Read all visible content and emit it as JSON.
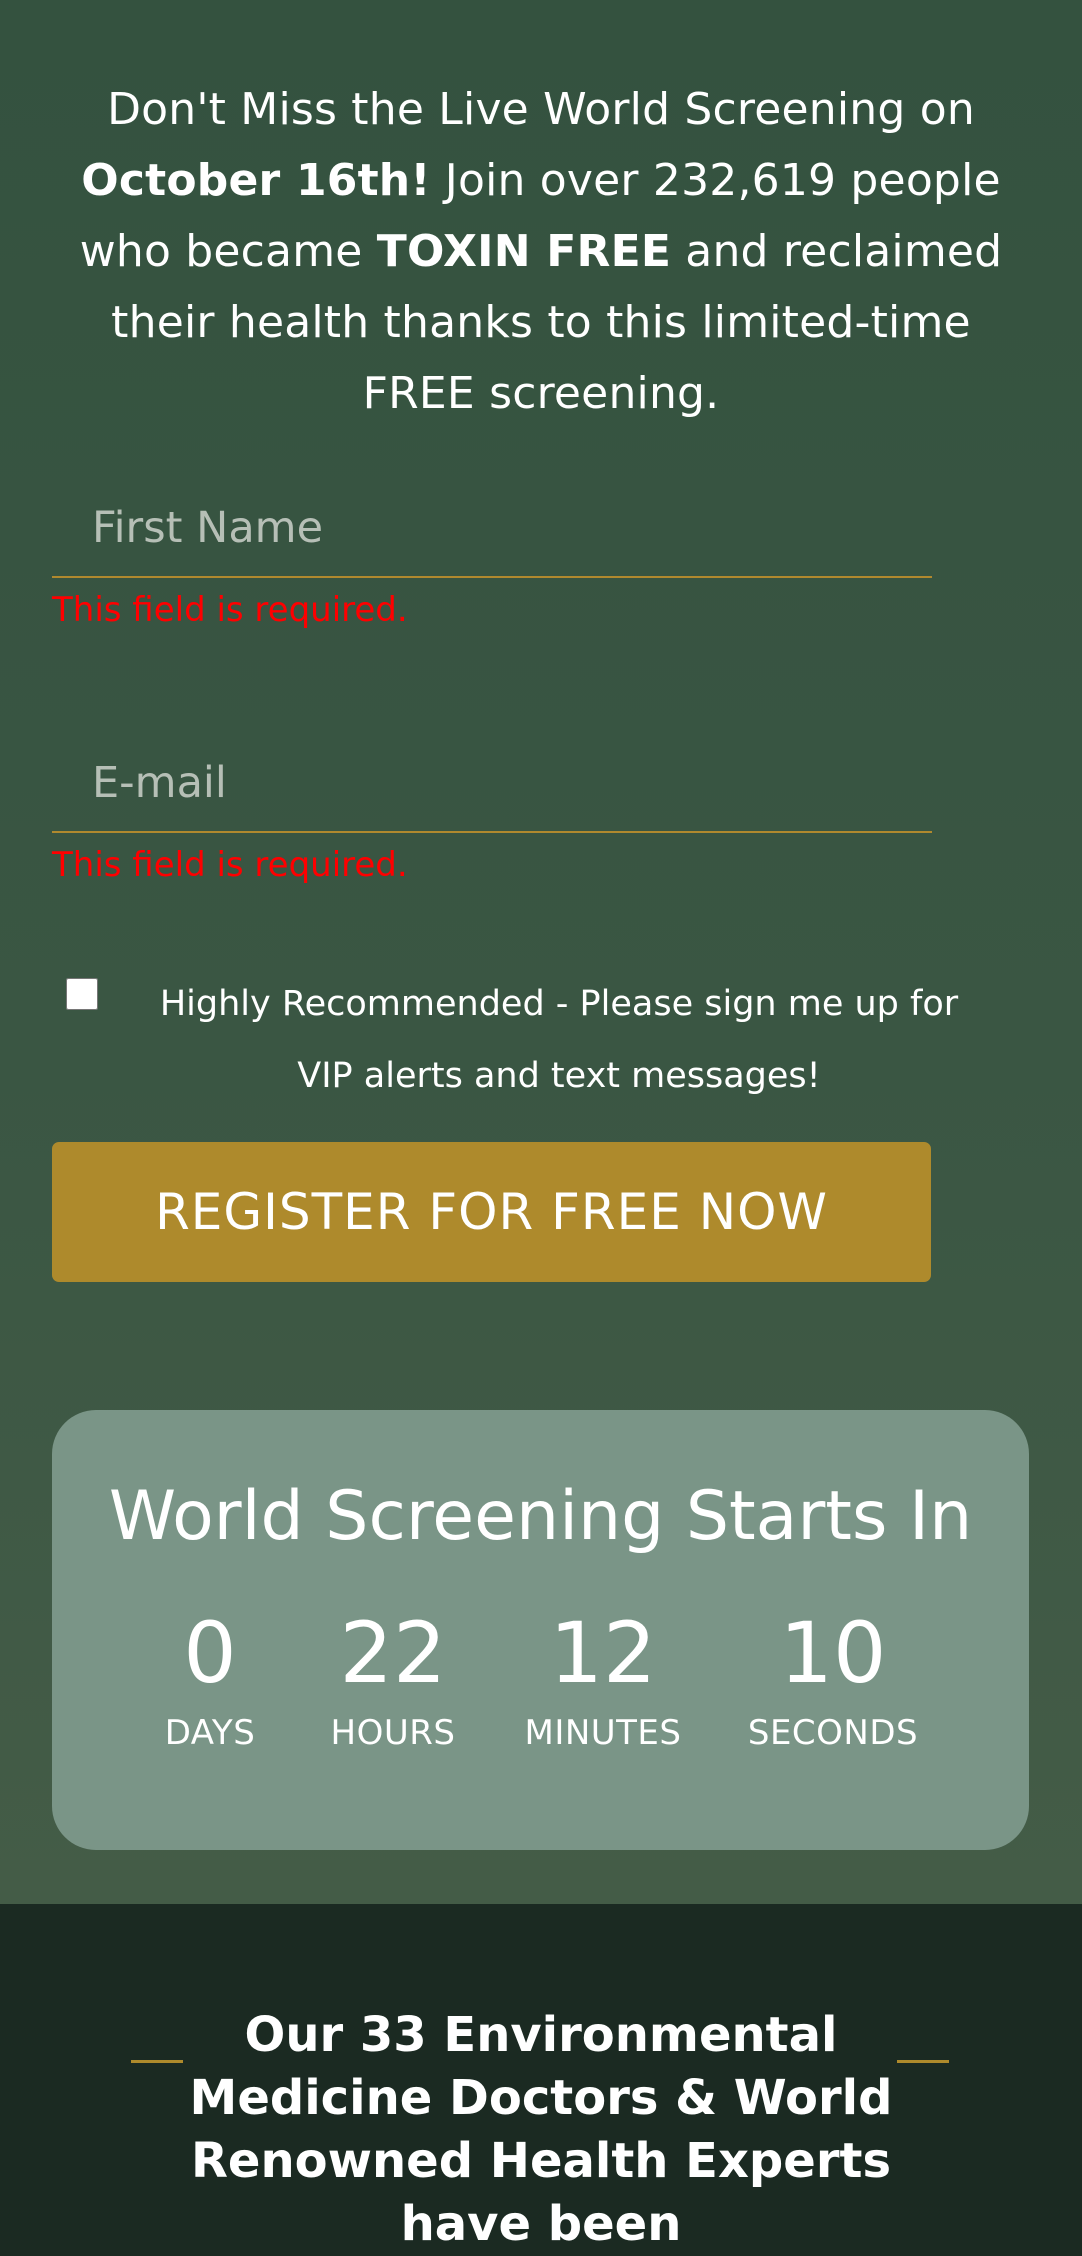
{
  "intro": {
    "part1": "Don't Miss the Live World Screening on ",
    "date": "October 16th!",
    "part2": " Join over 232,619 people who became ",
    "highlight": "TOXIN FREE",
    "part3": " and reclaimed their health thanks to this limited-time FREE screening."
  },
  "form": {
    "first_name_placeholder": "First Name",
    "first_name_value": "",
    "first_name_error": "This field is required.",
    "email_placeholder": "E-mail",
    "email_value": "",
    "email_error": "This field is required.",
    "vip_checked": false,
    "vip_label": "Highly Recommended - Please sign me up for VIP alerts and text messages!",
    "submit_label": "REGISTER FOR FREE NOW"
  },
  "countdown": {
    "title": "World Screening Starts In",
    "units": [
      {
        "value": "0",
        "label": "DAYS"
      },
      {
        "value": "22",
        "label": "HOURS"
      },
      {
        "value": "12",
        "label": "MINUTES"
      },
      {
        "value": "10",
        "label": "SECONDS"
      }
    ]
  },
  "experts": {
    "heading": "Our 33 Environmental Medicine Doctors & World Renowned Health Experts have been"
  },
  "colors": {
    "accent": "#ae8a2c",
    "error": "#ff0000",
    "hero_bg": "#34523f",
    "countdown_bg": "#7a9587",
    "footer_bg": "#1b2a22"
  }
}
